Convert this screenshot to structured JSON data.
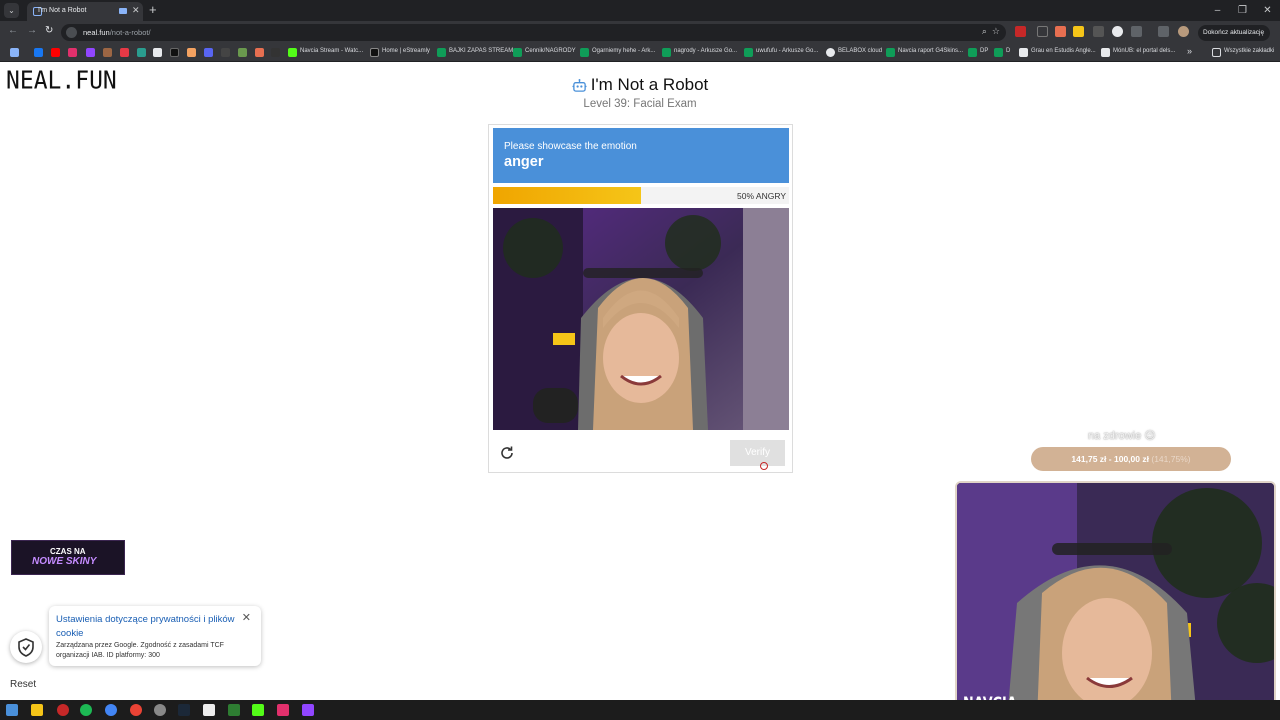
{
  "browser": {
    "tab_title": "I'm Not a Robot",
    "tab_menu_icon": "chevron-down-icon",
    "url_host": "neal.fun",
    "url_path": "/not-a-robot/",
    "update_button": "Dokończ aktualizację",
    "window_controls": [
      "–",
      "❐",
      "✕"
    ],
    "bookmarks": [
      "Navcia Stream - Watc...",
      "Home | eStreamly",
      "BAJKI ZAPAS STREAM",
      "Cennik/NAGRODY",
      "Ogarniemy hehe - Ark...",
      "nagrody - Arkusze Go...",
      "uwufufu - Arkusze Go...",
      "BELABOX cloud",
      "Navcia raport G4Skins...",
      "DP",
      "D",
      "Grau en Estudis Angle...",
      "MónUB: el portal dels...",
      "»",
      "Wszystkie zakładki"
    ]
  },
  "page": {
    "logo": "NEAL.FUN",
    "title": "I'm Not a Robot",
    "subtitle": "Level 39: Facial Exam"
  },
  "captcha": {
    "prompt": "Please showcase the emotion",
    "emotion": "anger",
    "meter_label": "50% ANGRY",
    "meter_value": 0.5,
    "verify_label": "Verify",
    "header_color": "#4a90d9",
    "meter_color": "#f0a500"
  },
  "overlays": {
    "goal_text": "na zdrowie 😉",
    "goal_amount": "141,75 zł",
    "goal_sep": "-",
    "goal_target": "100,00 zł",
    "goal_pct": "(141,75%)",
    "webcam_name": "NAVCIA",
    "promo_line1": "CZAS NA",
    "promo_line2": "NOWE SKINY"
  },
  "cookie": {
    "title": "Ustawienia dotyczące prywatności i plików cookie",
    "description": "Zarządzana przez Google. Zgodność z zasadami TCF organizacji IAB. ID platformy: 300",
    "close": "✕"
  },
  "reset_label": "Reset"
}
